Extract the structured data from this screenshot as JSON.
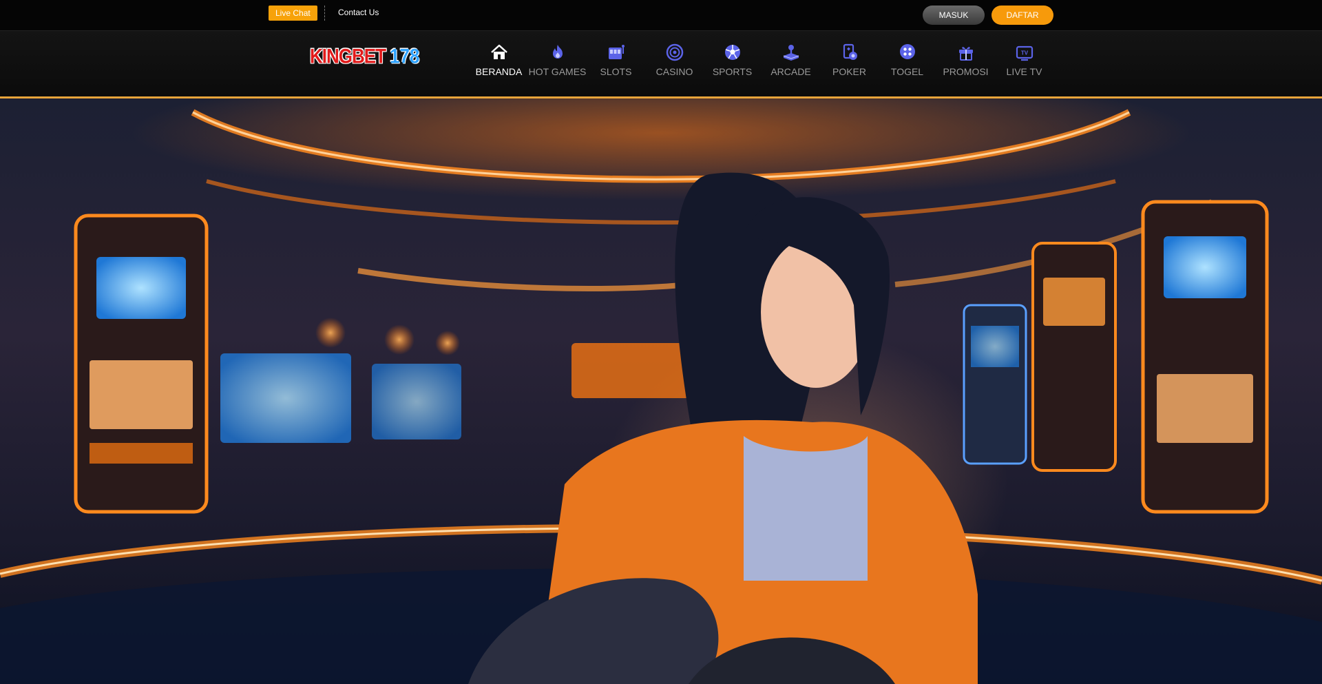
{
  "topbar": {
    "live_chat": "Live Chat",
    "contact_us": "Contact Us",
    "login": "MASUK",
    "register": "DAFTAR"
  },
  "logo": {
    "part1": "KINGBET",
    "part2": "178"
  },
  "nav": [
    {
      "label": "BERANDA",
      "icon": "home-icon",
      "active": true
    },
    {
      "label": "HOT GAMES",
      "icon": "fire-icon"
    },
    {
      "label": "SLOTS",
      "icon": "slot-machine-icon"
    },
    {
      "label": "CASINO",
      "icon": "roulette-icon"
    },
    {
      "label": "SPORTS",
      "icon": "soccer-ball-icon"
    },
    {
      "label": "ARCADE",
      "icon": "joystick-icon"
    },
    {
      "label": "POKER",
      "icon": "poker-cards-icon"
    },
    {
      "label": "TOGEL",
      "icon": "lottery-ball-icon"
    },
    {
      "label": "PROMOSI",
      "icon": "gift-icon"
    },
    {
      "label": "LIVE TV",
      "icon": "tv-icon"
    }
  ],
  "colors": {
    "accent_orange": "#f7a20a",
    "nav_icon": "#5b63e8",
    "nav_active": "#ffffff",
    "nav_inactive": "#9a9a9a",
    "accent_line": "#e8a43a"
  }
}
